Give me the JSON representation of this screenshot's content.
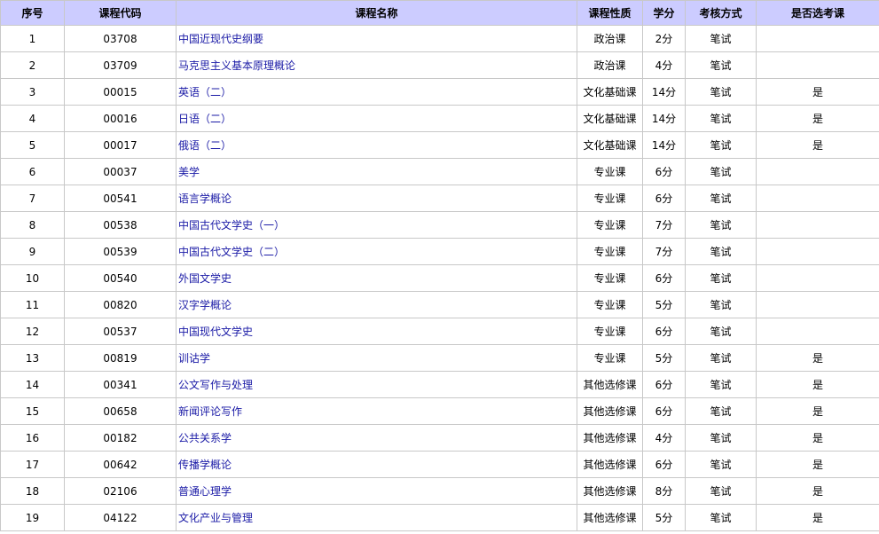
{
  "table": {
    "headers": [
      "序号",
      "课程代码",
      "课程名称",
      "课程性质",
      "学分",
      "考核方式",
      "是否选考课"
    ],
    "rows": [
      {
        "no": "1",
        "code": "03708",
        "name": "中国近现代史纲要",
        "type": "政治课",
        "credit": "2分",
        "exam": "笔试",
        "elective": ""
      },
      {
        "no": "2",
        "code": "03709",
        "name": "马克思主义基本原理概论",
        "type": "政治课",
        "credit": "4分",
        "exam": "笔试",
        "elective": ""
      },
      {
        "no": "3",
        "code": "00015",
        "name": "英语（二）",
        "type": "文化基础课",
        "credit": "14分",
        "exam": "笔试",
        "elective": "是"
      },
      {
        "no": "4",
        "code": "00016",
        "name": "日语（二）",
        "type": "文化基础课",
        "credit": "14分",
        "exam": "笔试",
        "elective": "是"
      },
      {
        "no": "5",
        "code": "00017",
        "name": "俄语（二）",
        "type": "文化基础课",
        "credit": "14分",
        "exam": "笔试",
        "elective": "是"
      },
      {
        "no": "6",
        "code": "00037",
        "name": "美学",
        "type": "专业课",
        "credit": "6分",
        "exam": "笔试",
        "elective": ""
      },
      {
        "no": "7",
        "code": "00541",
        "name": "语言学概论",
        "type": "专业课",
        "credit": "6分",
        "exam": "笔试",
        "elective": ""
      },
      {
        "no": "8",
        "code": "00538",
        "name": "中国古代文学史（一）",
        "type": "专业课",
        "credit": "7分",
        "exam": "笔试",
        "elective": ""
      },
      {
        "no": "9",
        "code": "00539",
        "name": "中国古代文学史（二）",
        "type": "专业课",
        "credit": "7分",
        "exam": "笔试",
        "elective": ""
      },
      {
        "no": "10",
        "code": "00540",
        "name": "外国文学史",
        "type": "专业课",
        "credit": "6分",
        "exam": "笔试",
        "elective": ""
      },
      {
        "no": "11",
        "code": "00820",
        "name": "汉字学概论",
        "type": "专业课",
        "credit": "5分",
        "exam": "笔试",
        "elective": ""
      },
      {
        "no": "12",
        "code": "00537",
        "name": "中国现代文学史",
        "type": "专业课",
        "credit": "6分",
        "exam": "笔试",
        "elective": ""
      },
      {
        "no": "13",
        "code": "00819",
        "name": "训诂学",
        "type": "专业课",
        "credit": "5分",
        "exam": "笔试",
        "elective": "是"
      },
      {
        "no": "14",
        "code": "00341",
        "name": "公文写作与处理",
        "type": "其他选修课",
        "credit": "6分",
        "exam": "笔试",
        "elective": "是"
      },
      {
        "no": "15",
        "code": "00658",
        "name": "新闻评论写作",
        "type": "其他选修课",
        "credit": "6分",
        "exam": "笔试",
        "elective": "是"
      },
      {
        "no": "16",
        "code": "00182",
        "name": "公共关系学",
        "type": "其他选修课",
        "credit": "4分",
        "exam": "笔试",
        "elective": "是"
      },
      {
        "no": "17",
        "code": "00642",
        "name": "传播学概论",
        "type": "其他选修课",
        "credit": "6分",
        "exam": "笔试",
        "elective": "是"
      },
      {
        "no": "18",
        "code": "02106",
        "name": "普通心理学",
        "type": "其他选修课",
        "credit": "8分",
        "exam": "笔试",
        "elective": "是"
      },
      {
        "no": "19",
        "code": "04122",
        "name": "文化产业与管理",
        "type": "其他选修课",
        "credit": "5分",
        "exam": "笔试",
        "elective": "是"
      }
    ]
  },
  "colors": {
    "header_bg": "#ccccff",
    "border": "#c8c8c8",
    "link": "#1a1aa6"
  }
}
